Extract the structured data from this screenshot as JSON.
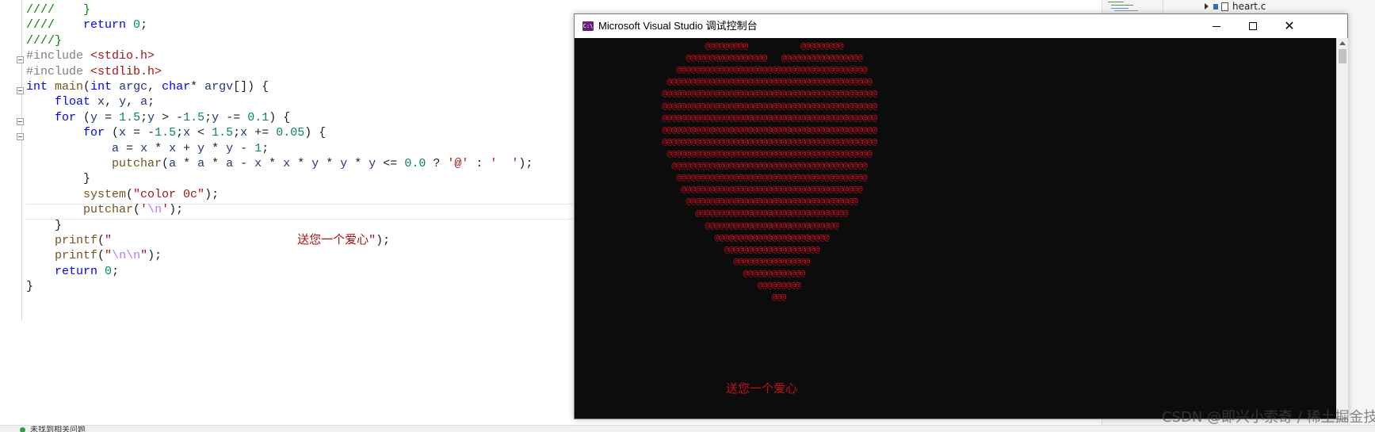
{
  "editor": {
    "code_lines": [
      [
        {
          "t": "////    }",
          "c": "cm"
        }
      ],
      [
        {
          "t": "////    ",
          "c": "cm"
        },
        {
          "t": "return",
          "c": "kw"
        },
        {
          "t": " ",
          "c": ""
        },
        {
          "t": "0",
          "c": "num"
        },
        {
          "t": ";",
          "c": ""
        }
      ],
      [
        {
          "t": "////}",
          "c": "cm"
        }
      ],
      [
        {
          "t": "#include ",
          "c": "pp"
        },
        {
          "t": "<stdio.h>",
          "c": "inc"
        }
      ],
      [
        {
          "t": "#include ",
          "c": "pp"
        },
        {
          "t": "<stdlib.h>",
          "c": "inc"
        }
      ],
      [
        {
          "t": "int",
          "c": "ty"
        },
        {
          "t": " ",
          "c": ""
        },
        {
          "t": "main",
          "c": "fn"
        },
        {
          "t": "(",
          "c": ""
        },
        {
          "t": "int",
          "c": "ty"
        },
        {
          "t": " ",
          "c": ""
        },
        {
          "t": "argc",
          "c": "id"
        },
        {
          "t": ", ",
          "c": ""
        },
        {
          "t": "char",
          "c": "ty"
        },
        {
          "t": "* ",
          "c": ""
        },
        {
          "t": "argv",
          "c": "id"
        },
        {
          "t": "[]) {",
          "c": ""
        }
      ],
      [
        {
          "t": "    ",
          "c": ""
        },
        {
          "t": "float",
          "c": "ty"
        },
        {
          "t": " ",
          "c": ""
        },
        {
          "t": "x",
          "c": "id"
        },
        {
          "t": ", ",
          "c": ""
        },
        {
          "t": "y",
          "c": "id"
        },
        {
          "t": ", ",
          "c": ""
        },
        {
          "t": "a",
          "c": "id"
        },
        {
          "t": ";",
          "c": ""
        }
      ],
      [
        {
          "t": "    ",
          "c": ""
        },
        {
          "t": "for",
          "c": "kw"
        },
        {
          "t": " (",
          "c": ""
        },
        {
          "t": "y",
          "c": "id"
        },
        {
          "t": " = ",
          "c": ""
        },
        {
          "t": "1.5",
          "c": "num"
        },
        {
          "t": ";",
          "c": ""
        },
        {
          "t": "y",
          "c": "id"
        },
        {
          "t": " > -",
          "c": ""
        },
        {
          "t": "1.5",
          "c": "num"
        },
        {
          "t": ";",
          "c": ""
        },
        {
          "t": "y",
          "c": "id"
        },
        {
          "t": " -= ",
          "c": ""
        },
        {
          "t": "0.1",
          "c": "num"
        },
        {
          "t": ") {",
          "c": ""
        }
      ],
      [
        {
          "t": "        ",
          "c": ""
        },
        {
          "t": "for",
          "c": "kw"
        },
        {
          "t": " (",
          "c": ""
        },
        {
          "t": "x",
          "c": "id"
        },
        {
          "t": " = -",
          "c": ""
        },
        {
          "t": "1.5",
          "c": "num"
        },
        {
          "t": ";",
          "c": ""
        },
        {
          "t": "x",
          "c": "id"
        },
        {
          "t": " < ",
          "c": ""
        },
        {
          "t": "1.5",
          "c": "num"
        },
        {
          "t": ";",
          "c": ""
        },
        {
          "t": "x",
          "c": "id"
        },
        {
          "t": " += ",
          "c": ""
        },
        {
          "t": "0.05",
          "c": "num"
        },
        {
          "t": ") {",
          "c": ""
        }
      ],
      [
        {
          "t": "            ",
          "c": ""
        },
        {
          "t": "a",
          "c": "id"
        },
        {
          "t": " = ",
          "c": ""
        },
        {
          "t": "x",
          "c": "id"
        },
        {
          "t": " * ",
          "c": ""
        },
        {
          "t": "x",
          "c": "id"
        },
        {
          "t": " + ",
          "c": ""
        },
        {
          "t": "y",
          "c": "id"
        },
        {
          "t": " * ",
          "c": ""
        },
        {
          "t": "y",
          "c": "id"
        },
        {
          "t": " - ",
          "c": ""
        },
        {
          "t": "1",
          "c": "num"
        },
        {
          "t": ";",
          "c": ""
        }
      ],
      [
        {
          "t": "            ",
          "c": ""
        },
        {
          "t": "putchar",
          "c": "fn"
        },
        {
          "t": "(",
          "c": ""
        },
        {
          "t": "a",
          "c": "id"
        },
        {
          "t": " * ",
          "c": ""
        },
        {
          "t": "a",
          "c": "id"
        },
        {
          "t": " * ",
          "c": ""
        },
        {
          "t": "a",
          "c": "id"
        },
        {
          "t": " - ",
          "c": ""
        },
        {
          "t": "x",
          "c": "id"
        },
        {
          "t": " * ",
          "c": ""
        },
        {
          "t": "x",
          "c": "id"
        },
        {
          "t": " * ",
          "c": ""
        },
        {
          "t": "y",
          "c": "id"
        },
        {
          "t": " * ",
          "c": ""
        },
        {
          "t": "y",
          "c": "id"
        },
        {
          "t": " * ",
          "c": ""
        },
        {
          "t": "y",
          "c": "id"
        },
        {
          "t": " <= ",
          "c": ""
        },
        {
          "t": "0.0",
          "c": "num"
        },
        {
          "t": " ? ",
          "c": ""
        },
        {
          "t": "'@'",
          "c": "str"
        },
        {
          "t": " : ",
          "c": ""
        },
        {
          "t": "'  '",
          "c": "str"
        },
        {
          "t": ");",
          "c": ""
        }
      ],
      [
        {
          "t": "        }",
          "c": ""
        }
      ],
      [
        {
          "t": "        ",
          "c": ""
        },
        {
          "t": "system",
          "c": "fn"
        },
        {
          "t": "(",
          "c": ""
        },
        {
          "t": "\"color 0c\"",
          "c": "str"
        },
        {
          "t": ");",
          "c": ""
        }
      ],
      [
        {
          "t": "        ",
          "c": ""
        },
        {
          "t": "putchar",
          "c": "fn"
        },
        {
          "t": "(",
          "c": ""
        },
        {
          "t": "'",
          "c": "str"
        },
        {
          "t": "\\n",
          "c": "esc"
        },
        {
          "t": "'",
          "c": "str"
        },
        {
          "t": ");",
          "c": ""
        }
      ],
      [
        {
          "t": "    }",
          "c": ""
        }
      ],
      [
        {
          "t": "    ",
          "c": ""
        },
        {
          "t": "printf",
          "c": "fn"
        },
        {
          "t": "(",
          "c": ""
        },
        {
          "t": "\"                          送您一个爱心\"",
          "c": "str"
        },
        {
          "t": ");",
          "c": ""
        }
      ],
      [
        {
          "t": "    ",
          "c": ""
        },
        {
          "t": "printf",
          "c": "fn"
        },
        {
          "t": "(",
          "c": ""
        },
        {
          "t": "\"",
          "c": "str"
        },
        {
          "t": "\\n\\n",
          "c": "esc"
        },
        {
          "t": "\"",
          "c": "str"
        },
        {
          "t": ");",
          "c": ""
        }
      ],
      [
        {
          "t": "    ",
          "c": ""
        },
        {
          "t": "return",
          "c": "kw"
        },
        {
          "t": " ",
          "c": ""
        },
        {
          "t": "0",
          "c": "num"
        },
        {
          "t": ";",
          "c": ""
        }
      ],
      [
        {
          "t": "}",
          "c": ""
        }
      ]
    ]
  },
  "solution_explorer": {
    "file_name": "heart.c"
  },
  "status_bar": {
    "message": "未找到相关问题"
  },
  "console": {
    "title": "Microsoft Visual Studio 调试控制台",
    "app_icon_glyph": "C:\\",
    "heart_rows": [
      "                  @@@@@@@@@           @@@@@@@@@",
      "              @@@@@@@@@@@@@@@@@   @@@@@@@@@@@@@@@@@",
      "            @@@@@@@@@@@@@@@@@@@@@@@@@@@@@@@@@@@@@@@@",
      "          @@@@@@@@@@@@@@@@@@@@@@@@@@@@@@@@@@@@@@@@@@@",
      "         @@@@@@@@@@@@@@@@@@@@@@@@@@@@@@@@@@@@@@@@@@@@@",
      "         @@@@@@@@@@@@@@@@@@@@@@@@@@@@@@@@@@@@@@@@@@@@@",
      "         @@@@@@@@@@@@@@@@@@@@@@@@@@@@@@@@@@@@@@@@@@@@@",
      "         @@@@@@@@@@@@@@@@@@@@@@@@@@@@@@@@@@@@@@@@@@@@@",
      "         @@@@@@@@@@@@@@@@@@@@@@@@@@@@@@@@@@@@@@@@@@@@@",
      "          @@@@@@@@@@@@@@@@@@@@@@@@@@@@@@@@@@@@@@@@@@@",
      "           @@@@@@@@@@@@@@@@@@@@@@@@@@@@@@@@@@@@@@@@@",
      "            @@@@@@@@@@@@@@@@@@@@@@@@@@@@@@@@@@@@@@@@",
      "             @@@@@@@@@@@@@@@@@@@@@@@@@@@@@@@@@@@@@@",
      "              @@@@@@@@@@@@@@@@@@@@@@@@@@@@@@@@@@@@",
      "                @@@@@@@@@@@@@@@@@@@@@@@@@@@@@@@@",
      "                  @@@@@@@@@@@@@@@@@@@@@@@@@@@@",
      "                    @@@@@@@@@@@@@@@@@@@@@@@@",
      "                      @@@@@@@@@@@@@@@@@@@@",
      "                        @@@@@@@@@@@@@@@@",
      "                          @@@@@@@@@@@@@",
      "                             @@@@@@@@@",
      "                                @@@"
    ],
    "message": "送您一个爱心"
  },
  "watermark": {
    "text": "CSDN @即兴小索奇 / 稀土掘金技术社区"
  },
  "colors": {
    "console_text": "#c50f1f",
    "console_bg": "#0c0c0c",
    "vs_purple": "#68217a"
  }
}
